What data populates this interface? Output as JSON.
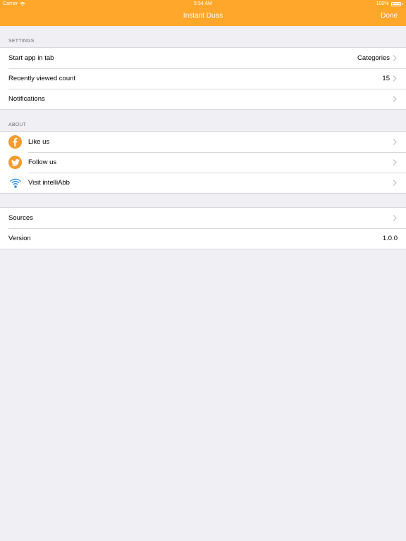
{
  "status_bar": {
    "carrier": "Carrier",
    "time": "5:54 AM",
    "battery": "100%"
  },
  "nav": {
    "title": "Instant Duas",
    "done_label": "Done"
  },
  "settings": {
    "header": "SETTINGS",
    "rows": [
      {
        "label": "Start app in tab",
        "value": "Categories"
      },
      {
        "label": "Recently viewed count",
        "value": "15"
      },
      {
        "label": "Notifications",
        "value": ""
      }
    ]
  },
  "about": {
    "header": "ABOUT",
    "rows": [
      {
        "label": "Like us",
        "icon": "facebook-icon"
      },
      {
        "label": "Follow us",
        "icon": "twitter-icon"
      },
      {
        "label": "Visit intelliAbb",
        "icon": "wifi-icon"
      }
    ]
  },
  "info": {
    "rows": [
      {
        "label": "Sources",
        "value": ""
      },
      {
        "label": "Version",
        "value": "1.0.0"
      }
    ]
  },
  "colors": {
    "accent": "#ffa72a",
    "background": "#efeff4",
    "icon_orange": "#f29b2e",
    "wifi_blue": "#2b8fe0"
  }
}
